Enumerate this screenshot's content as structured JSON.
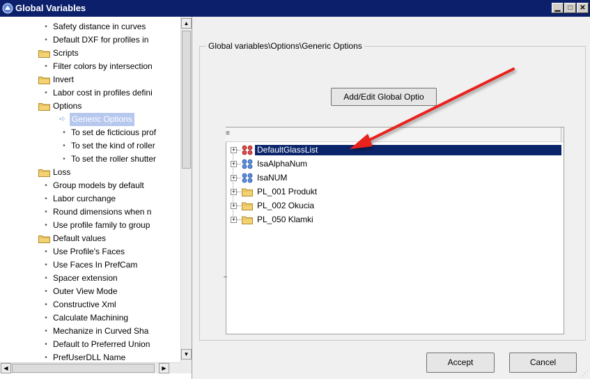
{
  "window": {
    "title": "Global Variables",
    "minimize_glyph": "▁",
    "maximize_glyph": "□",
    "close_glyph": "✕",
    "title_bar_color": "#0b1f6b"
  },
  "left_tree": {
    "rows": [
      {
        "type": "leaf",
        "label": "Safety distance in curves",
        "indent": 1
      },
      {
        "type": "leaf",
        "label": "Default DXF for profiles in",
        "indent": 1
      },
      {
        "type": "folder",
        "label": "Scripts",
        "indent": 0
      },
      {
        "type": "leaf",
        "label": "Filter colors by intersection",
        "indent": 1
      },
      {
        "type": "folder",
        "label": "Invert",
        "indent": 0
      },
      {
        "type": "leaf",
        "label": "Labor cost in profiles defini",
        "indent": 1
      },
      {
        "type": "folder",
        "label": "Options",
        "indent": 0
      },
      {
        "type": "selected",
        "label": "Generic Options",
        "indent": 1
      },
      {
        "type": "leaf",
        "label": "To set de ficticious prof",
        "indent": 2
      },
      {
        "type": "leaf",
        "label": "To set the kind of roller",
        "indent": 2
      },
      {
        "type": "leaf",
        "label": "To set the roller shutter",
        "indent": 2
      },
      {
        "type": "folder",
        "label": "Loss",
        "indent": 0
      },
      {
        "type": "leaf",
        "label": "Group models by default",
        "indent": 1
      },
      {
        "type": "leaf",
        "label": "Labor curchange",
        "indent": 1
      },
      {
        "type": "leaf",
        "label": "Round dimensions when n",
        "indent": 1
      },
      {
        "type": "leaf",
        "label": "Use profile family to group",
        "indent": 1
      },
      {
        "type": "folder",
        "label": "Default values",
        "indent": 0
      },
      {
        "type": "leaf",
        "label": "Use Profile's Faces",
        "indent": 1
      },
      {
        "type": "leaf",
        "label": "Use Faces In PrefCam",
        "indent": 1
      },
      {
        "type": "leaf",
        "label": "Spacer extension",
        "indent": 1
      },
      {
        "type": "leaf",
        "label": "Outer View Mode",
        "indent": 1
      },
      {
        "type": "leaf",
        "label": "Constructive Xml",
        "indent": 1
      },
      {
        "type": "leaf",
        "label": "Calculate Machining",
        "indent": 1
      },
      {
        "type": "leaf",
        "label": "Mechanize in Curved Sha",
        "indent": 1
      },
      {
        "type": "leaf",
        "label": "Default to Preferred Union",
        "indent": 1
      },
      {
        "type": "leaf",
        "label": "PrefUserDLL Name",
        "indent": 1
      }
    ],
    "scroll_up_glyph": "▲",
    "scroll_down_glyph": "▼",
    "scroll_left_glyph": "◀",
    "scroll_right_glyph": "▶"
  },
  "detail": {
    "group_label": "Global variables\\Options\\Generic Options",
    "add_button_label": "Add/Edit  Global Optio",
    "header_mark": "≡",
    "items": [
      {
        "label": "DefaultGlassList",
        "icon": "red-variable-icon",
        "selected": true
      },
      {
        "label": "IsaAlphaNum",
        "icon": "blue-variable-icon",
        "selected": false
      },
      {
        "label": "IsaNUM",
        "icon": "blue-variable-icon",
        "selected": false
      },
      {
        "label": "PL_001 Produkt",
        "icon": "folder-icon",
        "selected": false
      },
      {
        "label": "PL_002 Okucia",
        "icon": "folder-icon",
        "selected": false
      },
      {
        "label": "PL_050 Klamki",
        "icon": "folder-icon",
        "selected": false
      }
    ],
    "expander_glyph": "+",
    "selection_color": "#0a246a",
    "annotation_arrow_color": "#e8201e"
  },
  "footer": {
    "accept_label": "Accept",
    "cancel_label": "Cancel",
    "grip_glyph": "⋰"
  }
}
